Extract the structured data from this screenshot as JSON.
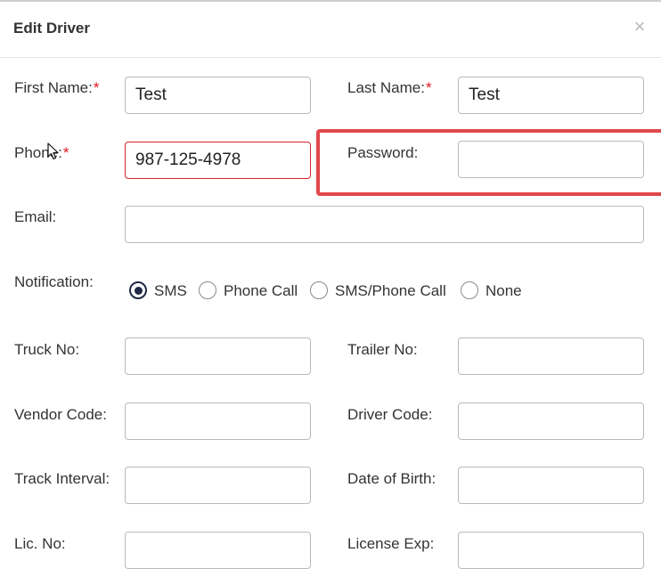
{
  "modal": {
    "title": "Edit Driver",
    "close_symbol": "×"
  },
  "required_marker": "*",
  "form": {
    "first_name": {
      "label": "First Name:",
      "value": "Test"
    },
    "last_name": {
      "label": "Last Name:",
      "value": "Test"
    },
    "phone": {
      "label": "Phone:",
      "value": "987-125-4978"
    },
    "password": {
      "label": "Password:",
      "value": ""
    },
    "email": {
      "label": "Email:",
      "value": ""
    },
    "notification": {
      "label": "Notification:",
      "selected": "SMS",
      "options": [
        "SMS",
        "Phone Call",
        "SMS/Phone Call",
        "None"
      ]
    },
    "truck_no": {
      "label": "Truck No:",
      "value": ""
    },
    "trailer_no": {
      "label": "Trailer No:",
      "value": ""
    },
    "vendor_code": {
      "label": "Vendor Code:",
      "value": ""
    },
    "driver_code": {
      "label": "Driver Code:",
      "value": ""
    },
    "track_interval": {
      "label": "Track Interval:",
      "value": ""
    },
    "date_of_birth": {
      "label": "Date of Birth:",
      "value": ""
    },
    "lic_no": {
      "label": "Lic. No:",
      "value": ""
    },
    "license_exp": {
      "label": "License Exp:",
      "value": ""
    }
  },
  "colors": {
    "required": "#e0141b",
    "error_border": "#d9232d",
    "highlight": "#e0474c",
    "radio_checked": "#1f2a44"
  },
  "icons": {
    "cursor": "mouse-pointer-icon"
  }
}
